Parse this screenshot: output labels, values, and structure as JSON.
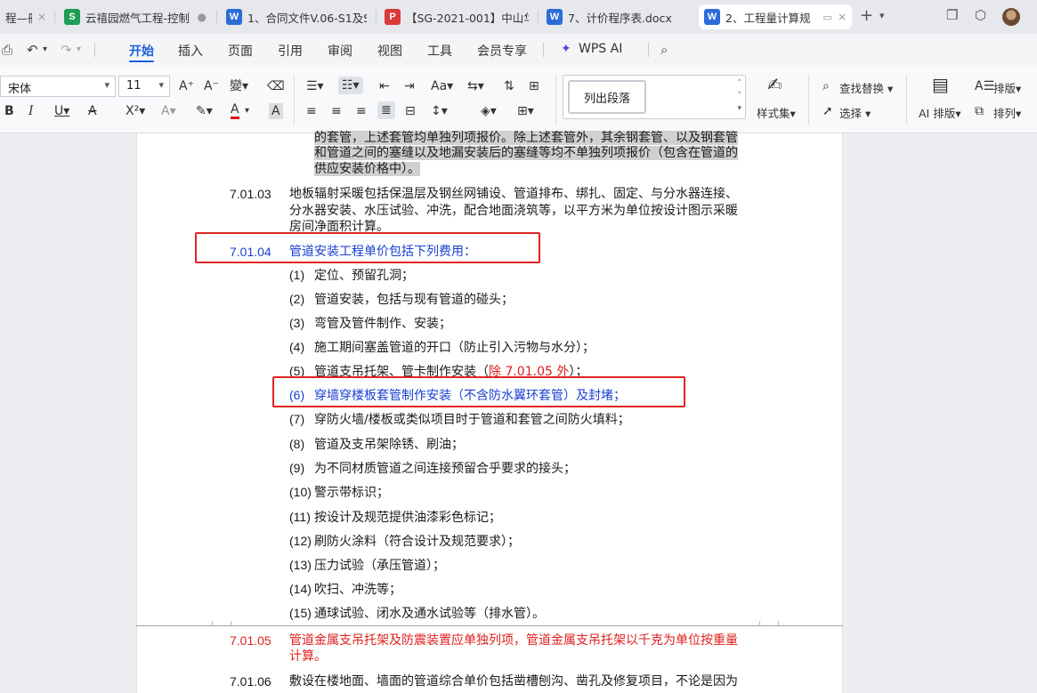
{
  "tabs": [
    {
      "label": "程—冊",
      "icon": "",
      "icon_color": "",
      "active": false
    },
    {
      "label": "云禧园燃气工程-控制",
      "icon": "S",
      "icon_color": "#1f9d55",
      "active": false
    },
    {
      "label": "1、合同文件V.06-S1及S2",
      "icon": "W",
      "icon_color": "#2b6cd9",
      "active": false
    },
    {
      "label": "【SG-2021-001】中山华",
      "icon": "P",
      "icon_color": "#d93a3a",
      "active": false
    },
    {
      "label": "7、计价程序表.docx",
      "icon": "W",
      "icon_color": "#2b6cd9",
      "active": false
    },
    {
      "label": "2、工程量计算规",
      "icon": "W",
      "icon_color": "#2b6cd9",
      "active": true
    }
  ],
  "menu": [
    "开始",
    "插入",
    "页面",
    "引用",
    "审阅",
    "视图",
    "工具",
    "会员专享",
    "WPS AI"
  ],
  "ribbon": {
    "font_name": "宋体",
    "font_size": "11",
    "style_preview": "列出段落",
    "style_set": "样式集",
    "find_replace": "查找替换",
    "select": "选择",
    "ai_layout": "AI 排版",
    "layout": "排版",
    "arrange": "排列"
  },
  "document": {
    "top_continuation": [
      "的套管，上述套管均单独列项报价。除上述套管外，其余钢套管、以及钢套管",
      "和管道之间的塞缝以及地漏安装后的塞缝等均不单独列项报价（包含在管道的",
      "供应安装价格中）。"
    ],
    "c0703": {
      "num": "7.01.03",
      "lines": [
        "地板辐射采暖包括保温层及钢丝网铺设、管道排布、绑扎、固定、与分水器连接、",
        "分水器安装、水压试验、冲洗，配合地面浇筑等，以平方米为单位按设计图示采暖",
        "房间净面积计算。"
      ]
    },
    "c0704": {
      "num": "7.01.04",
      "text": "管道安装工程单价包括下列费用："
    },
    "items": [
      {
        "n": "(1)",
        "text": "定位、预留孔洞；"
      },
      {
        "n": "(2)",
        "text": "管道安装，包括与现有管道的碰头；"
      },
      {
        "n": "(3)",
        "text": "弯管及管件制作、安装；"
      },
      {
        "n": "(4)",
        "text": "施工期间塞盖管道的开口（防止引入污物与水分）；"
      },
      {
        "n": "(5)",
        "text": "管道支吊托架、管卡制作安装（",
        "red": "除 7.01.05 外",
        "tail": "）；"
      },
      {
        "n": "(6)",
        "text": "穿墙穿楼板套管制作安装（不含防水翼环套管）及封堵；"
      },
      {
        "n": "(7)",
        "text": "穿防火墙/楼板或类似项目时于管道和套管之间防火填料；"
      },
      {
        "n": "(8)",
        "text": "管道及支吊架除锈、刷油；"
      },
      {
        "n": "(9)",
        "text": "为不同材质管道之间连接预留合乎要求的接头；"
      },
      {
        "n": "(10)",
        "text": "警示带标识；"
      },
      {
        "n": "(11)",
        "text": "按设计及规范提供油漆彩色标记；"
      },
      {
        "n": "(12)",
        "text": "刷防火涂料（符合设计及规范要求）；"
      },
      {
        "n": "(13)",
        "text": "压力试验（承压管道）；"
      },
      {
        "n": "(14)",
        "text": "吹扫、冲洗等；"
      },
      {
        "n": "(15)",
        "text": "通球试验、闭水及通水试验等（排水管）。"
      }
    ],
    "c0705": {
      "num": "7.01.05",
      "lines": [
        "管道金属支吊托架及防震装置应单独列项，管道金属支吊托架以千克为单位按重量",
        "计算。"
      ]
    },
    "c0706": {
      "num": "7.01.06",
      "lines": [
        "敷设在楼地面、墙面的管道综合单价包括凿槽刨沟、凿孔及修复项目，不论是因为"
      ]
    }
  },
  "colors": {
    "accent": "#1a5fd8",
    "doc_blue": "#1a3fd1",
    "doc_red": "#e01e1e",
    "annot_red": "#e02424"
  }
}
